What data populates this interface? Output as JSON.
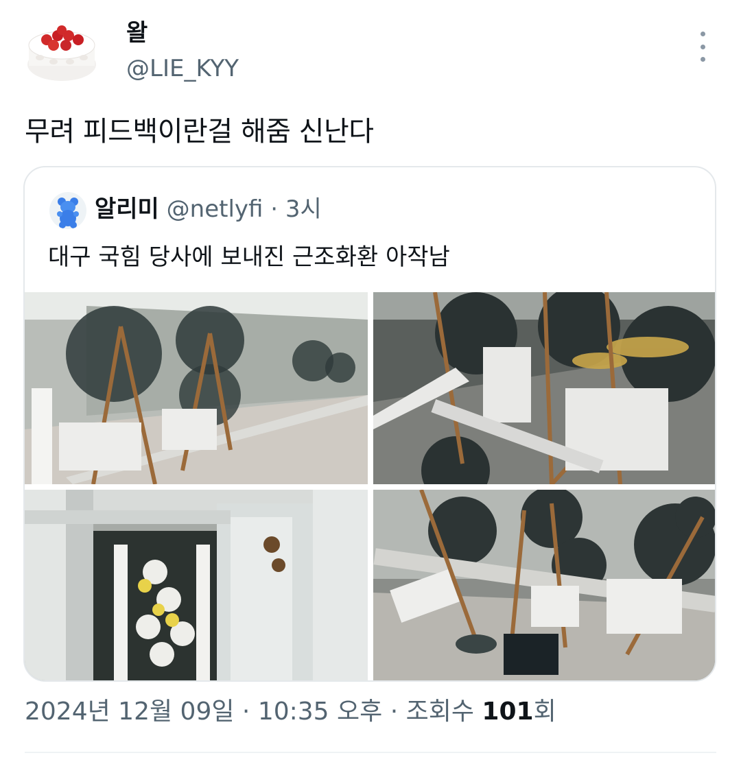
{
  "author": {
    "display_name": "왈",
    "handle": "@LIE_KYY",
    "avatar": "strawberry-cake-avatar"
  },
  "tweet": {
    "text": "무려 피드백이란걸 해줌 신난다"
  },
  "quoted_tweet": {
    "display_name": "알리미",
    "handle": "@netlyfi",
    "time": "· 3시",
    "avatar": "blue-gummy-bear-avatar",
    "text": "대구 국힘 당사에 보내진 근조화환 아작남",
    "photos": [
      {
        "name": "photo-1",
        "description": "toppled funeral wreaths along a wall"
      },
      {
        "name": "photo-2",
        "description": "broken funeral wreaths in a pile"
      },
      {
        "name": "photo-3",
        "description": "funeral wreath behind a rusty railing"
      },
      {
        "name": "photo-4",
        "description": "knocked over funeral wreaths on the ground"
      }
    ]
  },
  "footer": {
    "date": "2024년 12월 09일",
    "sep1": " · ",
    "time": "10:35 오후",
    "sep2": " · ",
    "views_label": "조회수 ",
    "views_count": "101",
    "views_suffix": "회"
  },
  "colors": {
    "text": "#0f1419",
    "secondary": "#536471",
    "border": "#e4e8eb"
  }
}
